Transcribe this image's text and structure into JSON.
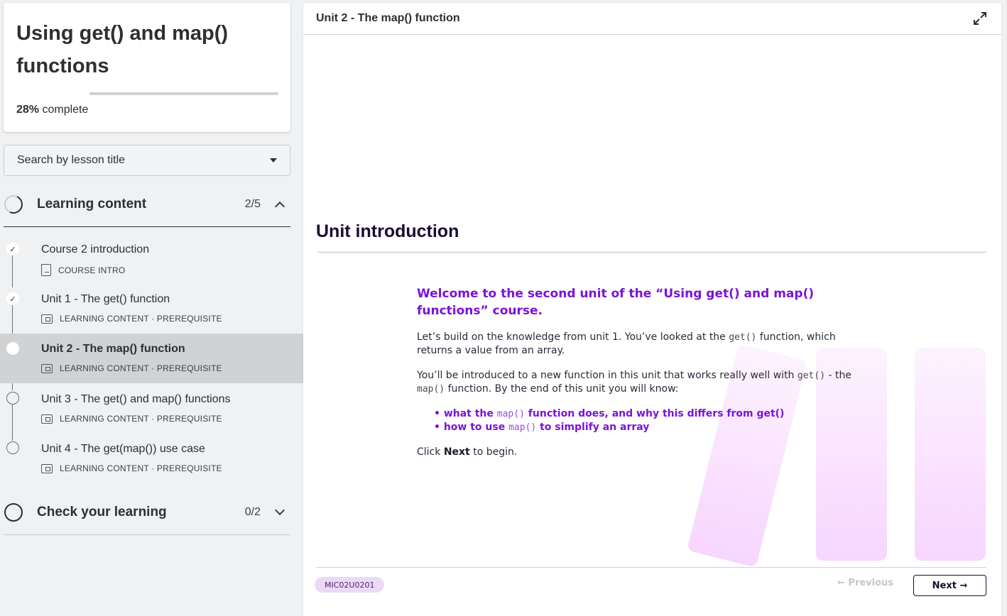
{
  "course": {
    "title": "Using get() and map() functions",
    "progress_percent": 28,
    "progress_value": "28%",
    "progress_suffix": " complete"
  },
  "search": {
    "placeholder": "Search by lesson title"
  },
  "sections": [
    {
      "label": "Learning content",
      "count": "2/5",
      "expanded": true,
      "lessons": [
        {
          "title": "Course 2 introduction",
          "meta": "COURSE INTRO",
          "status": "done",
          "icon": "document-icon"
        },
        {
          "title": "Unit 1 - The get() function",
          "meta": "LEARNING CONTENT · PREREQUISITE",
          "status": "done",
          "icon": "video-icon"
        },
        {
          "title": "Unit 2 - The map() function",
          "meta": "LEARNING CONTENT · PREREQUISITE",
          "status": "current",
          "icon": "video-icon"
        },
        {
          "title": "Unit 3 - The get() and map() functions",
          "meta": "LEARNING CONTENT · PREREQUISITE",
          "status": "todo",
          "icon": "video-icon"
        },
        {
          "title": "Unit 4 - The get(map()) use case",
          "meta": "LEARNING CONTENT · PREREQUISITE",
          "status": "todo",
          "icon": "video-icon"
        }
      ]
    },
    {
      "label": "Check your learning",
      "count": "0/2",
      "expanded": false
    }
  ],
  "main": {
    "unit_title": "Unit 2 - The map() function",
    "heading": "Unit introduction",
    "welcome": "Welcome to the second unit of the “Using get() and map() functions” course.",
    "p1_a": "Let’s build on the knowledge from unit 1. You’ve looked at the ",
    "p1_code": "get()",
    "p1_b": " function, which returns a value from an array.",
    "p2_a": "You’ll be introduced to a new function in this unit that works really well with ",
    "p2_code1": "get()",
    "p2_b": " - the ",
    "p2_code2": "map()",
    "p2_c": " function. By the end of this unit you will know:",
    "b1_a": "what the ",
    "b1_code": "map()",
    "b1_b": " function does, and why this differs from get()",
    "b2_a": "how to use ",
    "b2_code": "map()",
    "b2_b": " to simplify an array",
    "click_a": "Click ",
    "click_b": "Next",
    "click_c": " to begin.",
    "lesson_code": "MIC02U0201",
    "prev_label": "← Previous",
    "next_label": "Next →"
  },
  "colors": {
    "accent": "#7a13d8",
    "dark": "#1a0b33",
    "active_row": "#d1d2d4"
  }
}
